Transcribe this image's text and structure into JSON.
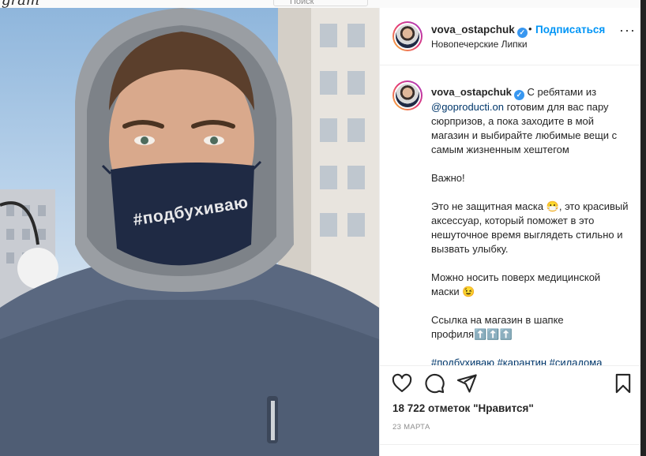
{
  "topbar": {
    "logo": "gram",
    "search_placeholder": "Поиск"
  },
  "post": {
    "username": "vova_ostapchuk",
    "follow_label": "Подписаться",
    "separator": "•",
    "location": "Новопечерские Липки",
    "more_label": "···",
    "mask_print": "#подбухиваю"
  },
  "caption": {
    "username": "vova_ostapchuk",
    "line1_a": "С ребятами из",
    "mention": "@goproducti.on",
    "line1_b": "готовим для вас пару сюрпризов, а пока заходите в мой магазин и выбирайте любимые вещи с самым жизненным хештегом",
    "p2": "Важно!",
    "p3": "Это не защитная маска 😷, это красивый аксессуар, который поможет в это нешуточное время выглядеть стильно и вызвать улыбку.",
    "p4": "Можно носить поверх медицинской маски 😉",
    "p5": "Ссылка на магазин в шапке профиля⬆️⬆️⬆️",
    "tags": "#подбухиваю #карантин #силадома"
  },
  "footer": {
    "likes": "18 722 отметок \"Нравится\"",
    "date": "23 МАРТА"
  },
  "icons": {
    "like": "heart-icon",
    "comment": "comment-icon",
    "share": "share-icon",
    "save": "bookmark-icon",
    "verified": "verified-badge-icon"
  },
  "colors": {
    "link": "#0095f6",
    "mention": "#00376b",
    "verified": "#3897f0"
  }
}
